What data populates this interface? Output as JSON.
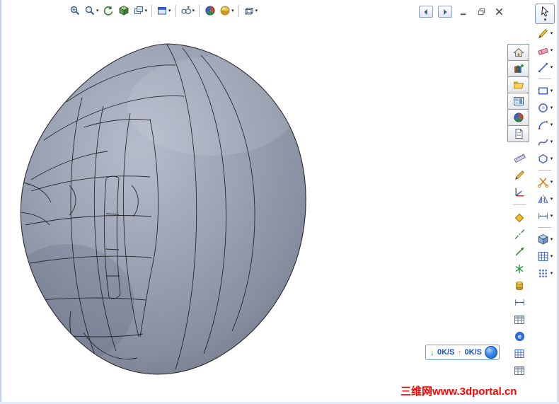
{
  "top_toolbar": {
    "icons": [
      "zoom-in",
      "zoom",
      "rotate-view",
      "shaded-cube",
      "viewports",
      "window",
      "view-orientation",
      "render-globe",
      "appearance",
      "display-style"
    ]
  },
  "window_controls": {
    "icons": [
      "back",
      "forward",
      "minimize",
      "restore",
      "close"
    ]
  },
  "task_pane": {
    "tabs": [
      "solidworks-resources",
      "design-library",
      "file-explorer",
      "view-palette",
      "appearances",
      "custom-properties"
    ]
  },
  "tools_toolbar": {
    "icons": [
      "measure",
      "sketch-pencil",
      "coordinate-axes",
      "point",
      "centerline",
      "axis",
      "origin-star",
      "cylinder",
      "dimension",
      "table",
      "edrawings",
      "grid",
      "design-table"
    ]
  },
  "sketch_toolbar": {
    "icons": [
      "select",
      "sketch",
      "eraser",
      "line",
      "rectangle",
      "circle",
      "arc",
      "spline",
      "polygon",
      "trim",
      "mirror",
      "smart-dimension",
      "extrude-cube",
      "grid",
      "linear-pattern"
    ]
  },
  "speed_widget": {
    "down_arrow": "↓",
    "down_value": "0K/S",
    "up_arrow": "↑",
    "up_value": "0K/S"
  },
  "watermark": {
    "text": "三维网www.3dportal.cn"
  },
  "colors": {
    "model_fill": "#98a0b2",
    "model_edge": "#1e1e22",
    "accent_blue": "#3a5fc8",
    "watermark_red": "#ff0000"
  }
}
